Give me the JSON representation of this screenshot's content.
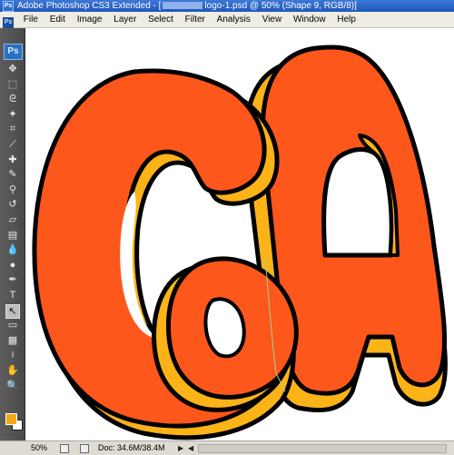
{
  "window": {
    "title_prefix": "Adobe Photoshop CS3 Extended - [",
    "title_suffix": "logo-1.psd @ 50% (Shape 9, RGB/8)]",
    "app_icon": "Ps"
  },
  "menu": {
    "logo": "Ps",
    "items": [
      "File",
      "Edit",
      "Image",
      "Layer",
      "Select",
      "Filter",
      "Analysis",
      "View",
      "Window",
      "Help"
    ]
  },
  "toolbox": {
    "logo": "Ps",
    "tools": [
      {
        "name": "move-tool-icon",
        "glyph": "✥"
      },
      {
        "name": "marquee-tool-icon",
        "glyph": "⬚"
      },
      {
        "name": "lasso-tool-icon",
        "glyph": "ᘓ"
      },
      {
        "name": "magic-wand-tool-icon",
        "glyph": "✦"
      },
      {
        "name": "crop-tool-icon",
        "glyph": "⌗"
      },
      {
        "name": "slice-tool-icon",
        "glyph": "⟋"
      },
      {
        "name": "healing-brush-tool-icon",
        "glyph": "✚"
      },
      {
        "name": "brush-tool-icon",
        "glyph": "✎"
      },
      {
        "name": "clone-stamp-tool-icon",
        "glyph": "⚲"
      },
      {
        "name": "history-brush-tool-icon",
        "glyph": "↺"
      },
      {
        "name": "eraser-tool-icon",
        "glyph": "▱"
      },
      {
        "name": "gradient-tool-icon",
        "glyph": "▤"
      },
      {
        "name": "blur-tool-icon",
        "glyph": "💧"
      },
      {
        "name": "dodge-tool-icon",
        "glyph": "●"
      },
      {
        "name": "pen-tool-icon",
        "glyph": "✒"
      },
      {
        "name": "type-tool-icon",
        "glyph": "T"
      },
      {
        "name": "path-selection-tool-icon",
        "glyph": "↖"
      },
      {
        "name": "rectangle-tool-icon",
        "glyph": "▭"
      },
      {
        "name": "notes-tool-icon",
        "glyph": "▦"
      },
      {
        "name": "eyedropper-tool-icon",
        "glyph": "⟊"
      },
      {
        "name": "hand-tool-icon",
        "glyph": "✋"
      },
      {
        "name": "zoom-tool-icon",
        "glyph": "🔍"
      }
    ],
    "active_tool": "path-selection-tool-icon",
    "foreground_color": "#f4a71b",
    "background_color": "#ffffff"
  },
  "canvas": {
    "artwork": "GA",
    "colors": {
      "letter_face": "#fd571b",
      "letter_shadow": "#fcb318",
      "outline": "#000000"
    }
  },
  "status": {
    "zoom": "50%",
    "doc_info": "Doc: 34.6M/38.4M"
  }
}
